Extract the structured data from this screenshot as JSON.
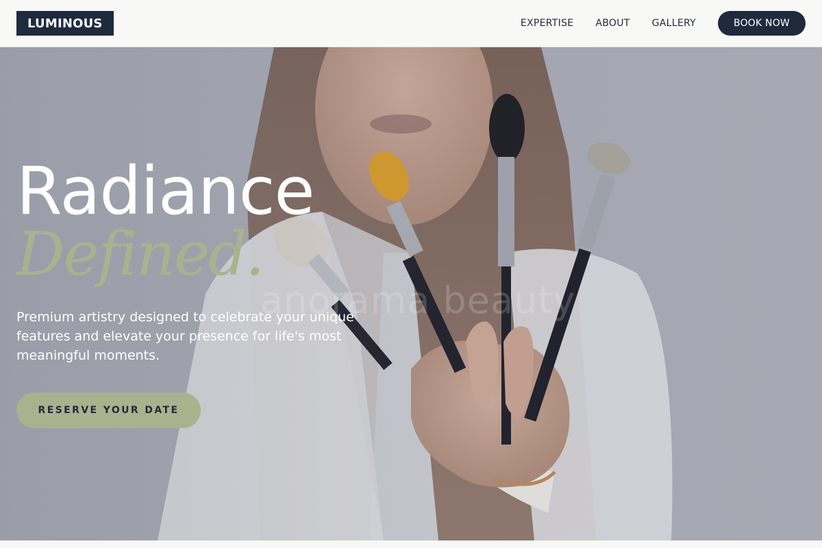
{
  "brand": {
    "logo_text": "LUMINOUS"
  },
  "nav": {
    "links": [
      "EXPERTISE",
      "ABOUT",
      "GALLERY"
    ],
    "cta_label": "BOOK NOW"
  },
  "hero": {
    "title_line1": "Radiance",
    "title_line2": "Defined.",
    "tagline": "Premium artistry designed to celebrate your unique features and elevate your presence for life's most meaningful moments.",
    "cta_label": "RESERVE YOUR DATE",
    "watermark_text": "anorama beauty"
  },
  "colors": {
    "navy": "#1f2a3d",
    "sage": "#aab28d",
    "nav_bg": "#f8f8f6",
    "hero_bg": "#a4a6b1"
  }
}
